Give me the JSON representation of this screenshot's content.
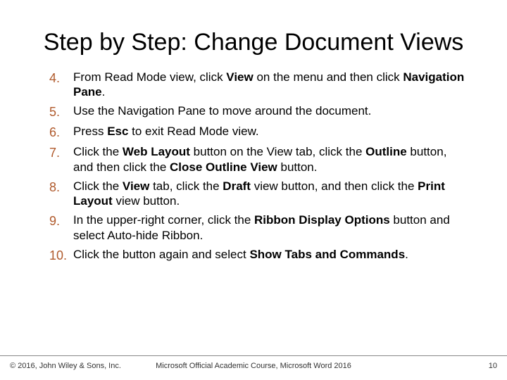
{
  "title": "Step by Step: Change Document Views",
  "steps": [
    {
      "num": "4.",
      "html": "From Read Mode view, click <b>View</b> on the menu and then click <b>Navigation Pane</b>."
    },
    {
      "num": "5.",
      "html": "Use the Navigation Pane to move around the document."
    },
    {
      "num": "6.",
      "html": "Press <b>Esc</b> to exit Read Mode view."
    },
    {
      "num": "7.",
      "html": "Click the <b>Web Layout</b> button on the View tab, click the <b>Outline</b> button, and then click the <b>Close Outline View</b> button."
    },
    {
      "num": "8.",
      "html": "Click the <b>View</b> tab, click the <b>Draft</b> view button, and then click the <b>Print Layout</b> view button."
    },
    {
      "num": "9.",
      "html": "In the upper-right corner, click the <b>Ribbon Display Options</b>  button and select Auto-hide Ribbon."
    },
    {
      "num": "10.",
      "html": "Click the button again and select <b>Show Tabs and Commands</b>."
    }
  ],
  "footer": {
    "left": "© 2016, John Wiley & Sons, Inc.",
    "center": "Microsoft Official Academic Course, Microsoft Word 2016",
    "right": "10"
  }
}
